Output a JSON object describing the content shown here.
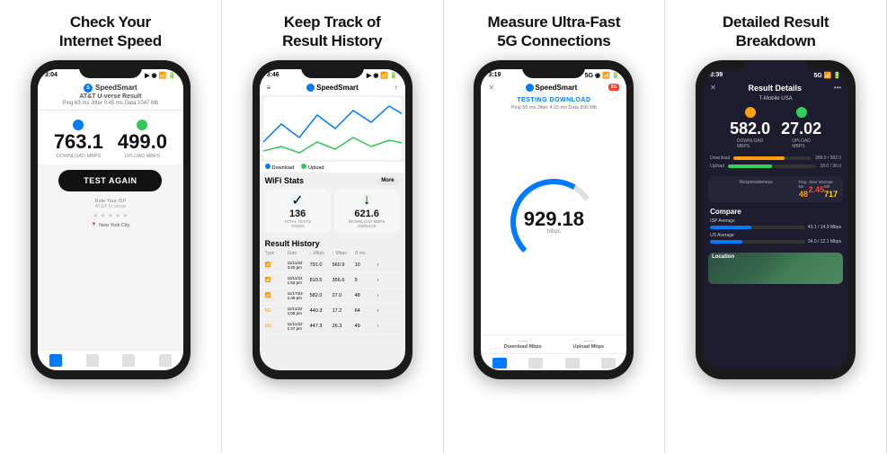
{
  "panels": [
    {
      "id": "panel1",
      "title_line1": "Check Your",
      "title_line2": "Internet Speed",
      "phone": {
        "status_time": "3:04",
        "isp_result": "AT&T U-verse Result",
        "meta": "Ping 63 ms   Jitter 0.45 ms   Data 1047 Mb",
        "download_speed": "763.1",
        "upload_speed": "499.0",
        "download_label": "Download Mbps",
        "upload_label": "Upload Mbps",
        "test_btn": "TEST AGAIN",
        "isp_name": "AT&T U-verse",
        "location": "New York City",
        "logo": "SpeedSmart"
      }
    },
    {
      "id": "panel2",
      "title_line1": "Keep Track of",
      "title_line2": "Result History",
      "phone": {
        "status_time": "3:46",
        "logo": "SpeedSmart",
        "wifi_stats_title": "WiFi Stats",
        "more_btn": "More",
        "total_tests": "136",
        "total_tests_label": "TOTAL TESTS\nTAKEN",
        "avg_download": "621.6",
        "avg_download_label": "DOWNLOAD MBPS\nAVERAGE",
        "history_title": "Result History",
        "table_headers": [
          "Type",
          "Date",
          "↓ Mbps",
          "↑ Mbps",
          "⏱ ms"
        ],
        "rows": [
          {
            "type": "wifi",
            "date": "11/11/22\n3:20 pm",
            "dl": "791.0",
            "ul": "560.9",
            "ms": "10"
          },
          {
            "type": "wifi",
            "date": "11/11/22\n1:52 pm",
            "dl": "810.5",
            "ul": "356.6",
            "ms": "5"
          },
          {
            "type": "wifi",
            "date": "11/17/22\n1:48 pm",
            "dl": "582.0",
            "ul": "27.0",
            "ms": "48"
          },
          {
            "type": "lte",
            "date": "11/11/22\n1:06 pm",
            "dl": "440.3",
            "ul": "17.2",
            "ms": "64"
          },
          {
            "type": "lte",
            "date": "11/11/22\n1:47 pm",
            "dl": "447.3",
            "ul": "26.3",
            "ms": "49"
          }
        ]
      }
    },
    {
      "id": "panel3",
      "title_line1": "Measure Ultra-Fast",
      "title_line2": "5G Connections",
      "phone": {
        "status_time": "3:19",
        "logo": "SpeedSmart",
        "badge_5g": "5G",
        "test_status": "TESTING DOWNLOAD",
        "meta": "Ping 55 ms   Jitter 4.15 ms   Data 800 Mb",
        "speed": "929.18",
        "speed_unit": "Mbps",
        "dl_label": "Download Mbps",
        "ul_label": "Upload Mbps"
      }
    },
    {
      "id": "panel4",
      "title_line1": "Detailed Result",
      "title_line2": "Breakdown",
      "phone": {
        "status_time": "3:39",
        "title": "Result Details",
        "isp": "T-Mobile USA",
        "download_speed": "582.0",
        "upload_speed": "27.02",
        "download_label": "Download\nMbps",
        "upload_label": "Upload\nMbps",
        "bar_dl_label": "Download",
        "bar_dl_val": "388.0 / 582.0 Mbps",
        "bar_ul_label": "Upload",
        "bar_ul_val": "18.0 / 36.0 Mbps",
        "responsiveness_label": "Responsiveness",
        "ping": "48",
        "ping_label": "Ping Ms",
        "jitter": "2.45",
        "jitter_label": "Jitter Ms",
        "data_mb": "717",
        "data_label": "Data Mb",
        "compare_title": "Compare",
        "isp_avg_label": "ISP Average",
        "isp_avg_val": "43.1 / 14.9 Mbps",
        "us_avg_label": "US Average",
        "us_avg_val": "34.0 / 12.1 Mbps",
        "location_label": "Location"
      }
    }
  ]
}
